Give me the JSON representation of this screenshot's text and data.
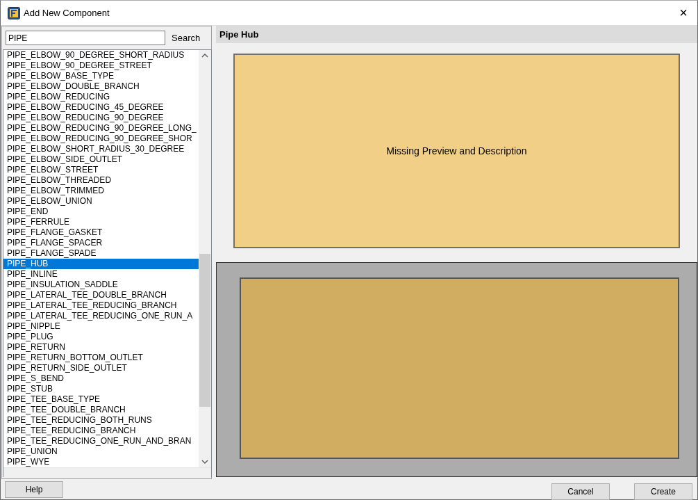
{
  "window": {
    "title": "Add New Component",
    "close": "×"
  },
  "search": {
    "value": "PIPE",
    "button": "Search"
  },
  "list": {
    "items": [
      {
        "label": "PIPE_ELBOW_90_DEGREE_SHORT_RADIUS",
        "selected": false
      },
      {
        "label": "PIPE_ELBOW_90_DEGREE_STREET",
        "selected": false
      },
      {
        "label": "PIPE_ELBOW_BASE_TYPE",
        "selected": false
      },
      {
        "label": "PIPE_ELBOW_DOUBLE_BRANCH",
        "selected": false
      },
      {
        "label": "PIPE_ELBOW_REDUCING",
        "selected": false
      },
      {
        "label": "PIPE_ELBOW_REDUCING_45_DEGREE",
        "selected": false
      },
      {
        "label": "PIPE_ELBOW_REDUCING_90_DEGREE",
        "selected": false
      },
      {
        "label": "PIPE_ELBOW_REDUCING_90_DEGREE_LONG_",
        "selected": false
      },
      {
        "label": "PIPE_ELBOW_REDUCING_90_DEGREE_SHOR",
        "selected": false
      },
      {
        "label": "PIPE_ELBOW_SHORT_RADIUS_30_DEGREE",
        "selected": false
      },
      {
        "label": "PIPE_ELBOW_SIDE_OUTLET",
        "selected": false
      },
      {
        "label": "PIPE_ELBOW_STREET",
        "selected": false
      },
      {
        "label": "PIPE_ELBOW_THREADED",
        "selected": false
      },
      {
        "label": "PIPE_ELBOW_TRIMMED",
        "selected": false
      },
      {
        "label": "PIPE_ELBOW_UNION",
        "selected": false
      },
      {
        "label": "PIPE_END",
        "selected": false
      },
      {
        "label": "PIPE_FERRULE",
        "selected": false
      },
      {
        "label": "PIPE_FLANGE_GASKET",
        "selected": false
      },
      {
        "label": "PIPE_FLANGE_SPACER",
        "selected": false
      },
      {
        "label": "PIPE_FLANGE_SPADE",
        "selected": false
      },
      {
        "label": "PIPE_HUB",
        "selected": true
      },
      {
        "label": "PIPE_INLINE",
        "selected": false
      },
      {
        "label": "PIPE_INSULATION_SADDLE",
        "selected": false
      },
      {
        "label": "PIPE_LATERAL_TEE_DOUBLE_BRANCH",
        "selected": false
      },
      {
        "label": "PIPE_LATERAL_TEE_REDUCING_BRANCH",
        "selected": false
      },
      {
        "label": "PIPE_LATERAL_TEE_REDUCING_ONE_RUN_A",
        "selected": false
      },
      {
        "label": "PIPE_NIPPLE",
        "selected": false
      },
      {
        "label": "PIPE_PLUG",
        "selected": false
      },
      {
        "label": "PIPE_RETURN",
        "selected": false
      },
      {
        "label": "PIPE_RETURN_BOTTOM_OUTLET",
        "selected": false
      },
      {
        "label": "PIPE_RETURN_SIDE_OUTLET",
        "selected": false
      },
      {
        "label": "PIPE_S_BEND",
        "selected": false
      },
      {
        "label": "PIPE_STUB",
        "selected": false
      },
      {
        "label": "PIPE_TEE_BASE_TYPE",
        "selected": false
      },
      {
        "label": "PIPE_TEE_DOUBLE_BRANCH",
        "selected": false
      },
      {
        "label": "PIPE_TEE_REDUCING_BOTH_RUNS",
        "selected": false
      },
      {
        "label": "PIPE_TEE_REDUCING_BRANCH",
        "selected": false
      },
      {
        "label": "PIPE_TEE_REDUCING_ONE_RUN_AND_BRAN",
        "selected": false
      },
      {
        "label": "PIPE_UNION",
        "selected": false
      },
      {
        "label": "PIPE_WYE",
        "selected": false
      }
    ]
  },
  "details": {
    "title": "Pipe Hub",
    "preview_message": "Missing Preview and Description"
  },
  "buttons": {
    "help": "Help",
    "cancel": "Cancel",
    "create": "Create"
  }
}
